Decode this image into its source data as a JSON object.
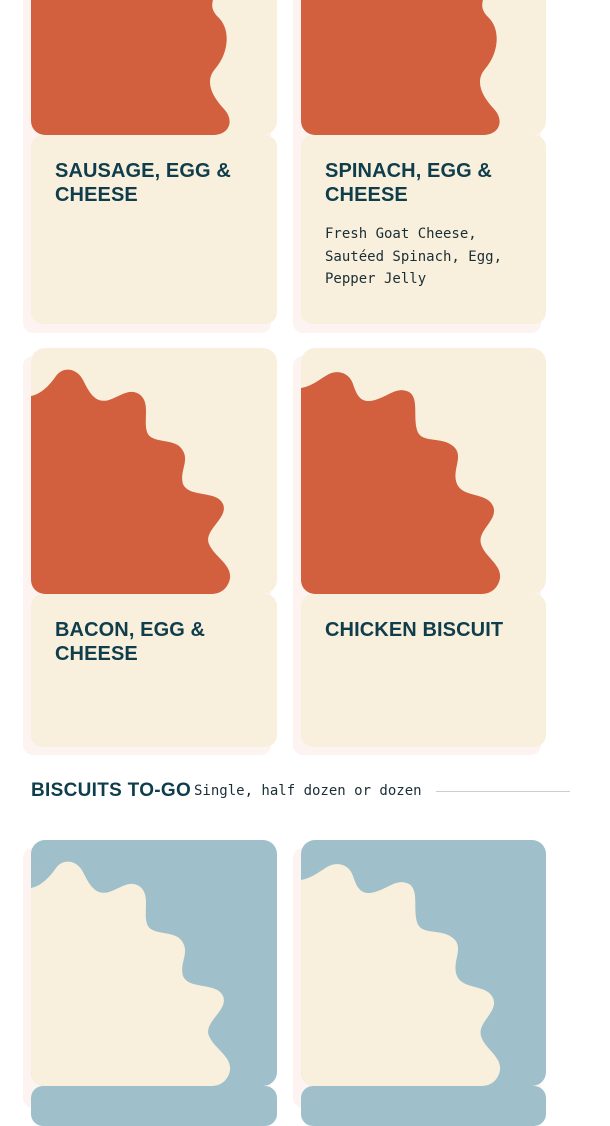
{
  "colors": {
    "card_background": "#f8f0dc",
    "accent_orange": "#d2603f",
    "accent_blue": "#9fc0ca",
    "heading_text": "#0f3d4c",
    "body_text": "#1a2e36"
  },
  "menu_items": [
    {
      "title": "SAUSAGE, EGG & CHEESE",
      "description": "",
      "icon": "biscuit-illustration-icon"
    },
    {
      "title": "SPINACH, EGG & CHEESE",
      "description": "Fresh Goat Cheese, Sautéed Spinach, Egg, Pepper Jelly",
      "icon": "biscuit-illustration-icon"
    },
    {
      "title": "BACON, EGG & CHEESE",
      "description": "",
      "icon": "biscuit-illustration-icon"
    },
    {
      "title": "CHICKEN BISCUIT",
      "description": "",
      "icon": "biscuit-illustration-icon"
    }
  ],
  "section": {
    "title": "BISCUITS TO-GO",
    "subtitle": "Single, half dozen or dozen"
  },
  "to_go_items": [
    {
      "icon": "biscuit-illustration-icon"
    },
    {
      "icon": "biscuit-illustration-icon"
    }
  ]
}
